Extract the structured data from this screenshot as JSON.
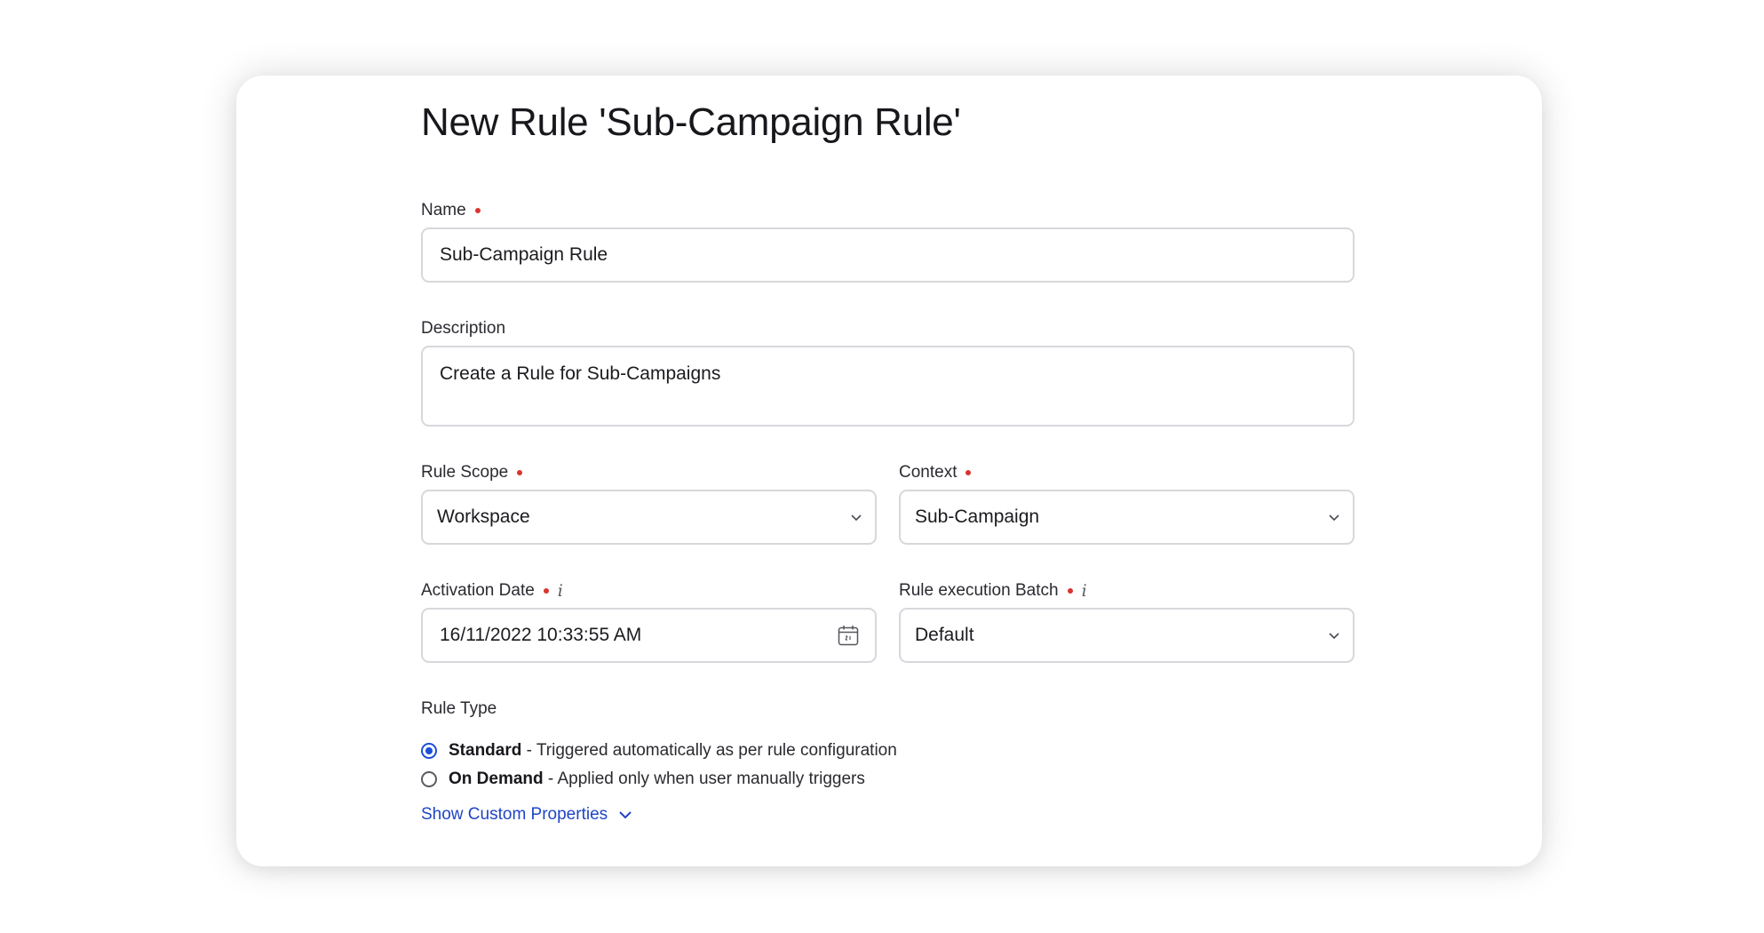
{
  "page": {
    "title": "New Rule 'Sub-Campaign Rule'"
  },
  "form": {
    "name": {
      "label": "Name",
      "value": "Sub-Campaign Rule"
    },
    "description": {
      "label": "Description",
      "value": "Create a Rule for Sub-Campaigns"
    },
    "rule_scope": {
      "label": "Rule Scope",
      "value": "Workspace"
    },
    "context": {
      "label": "Context",
      "value": "Sub-Campaign"
    },
    "activation_date": {
      "label": "Activation Date",
      "value": "16/11/2022 10:33:55 AM"
    },
    "execution_batch": {
      "label": "Rule execution Batch",
      "value": "Default"
    },
    "info_glyph": "i",
    "rule_type": {
      "label": "Rule Type",
      "options": [
        {
          "name": "Standard",
          "desc": " - Triggered automatically as per rule configuration",
          "selected": true
        },
        {
          "name": "On Demand",
          "desc": " - Applied only when user manually triggers",
          "selected": false
        }
      ]
    },
    "custom_properties_link": "Show Custom Properties"
  },
  "colors": {
    "accent": "#1d4ed8",
    "link": "#1f45c4",
    "required": "#d9342f"
  },
  "icons": [
    "chevron-down-icon",
    "calendar-icon",
    "info-icon"
  ]
}
